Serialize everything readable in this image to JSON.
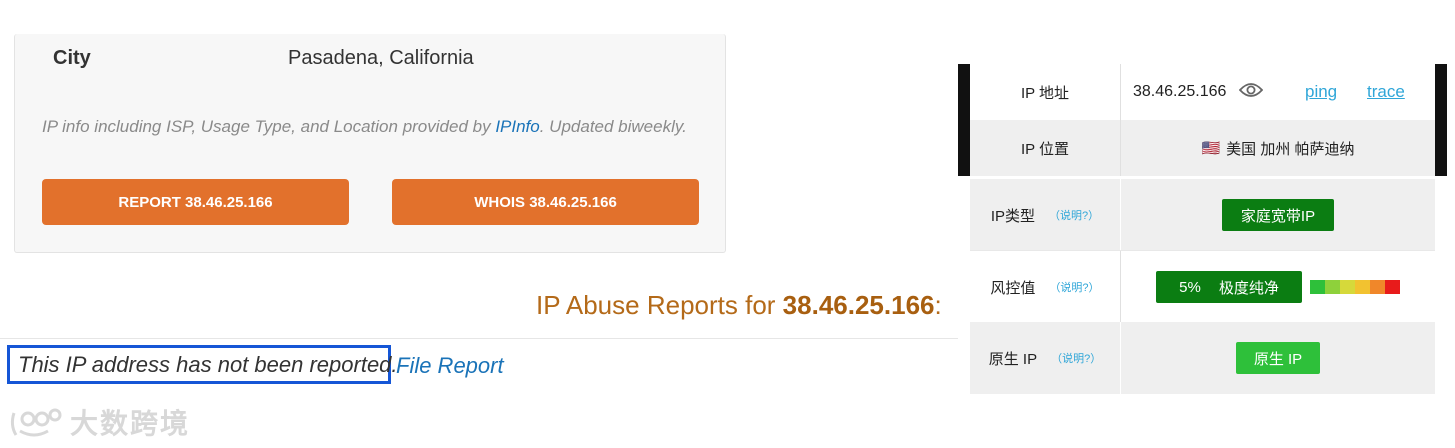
{
  "ip_info_card": {
    "city_label": "City",
    "city_value": "Pasadena, California",
    "note_prefix": "IP info including ISP, Usage Type, and Location provided by ",
    "note_link": "IPInfo",
    "note_suffix": ". Updated biweekly.",
    "report_button": "REPORT 38.46.25.166",
    "whois_button": "WHOIS 38.46.25.166"
  },
  "abuse": {
    "heading_prefix": "IP Abuse Reports for ",
    "heading_ip": "38.46.25.166",
    "heading_suffix": ":",
    "status_text": "This IP address has not been reported.",
    "file_report_link": "File Report"
  },
  "watermark": {
    "text": "大数跨境"
  },
  "ip_panel": {
    "address_label": "IP 地址",
    "address_value": "38.46.25.166",
    "ping_link": "ping",
    "trace_link": "trace",
    "location_label": "IP 位置",
    "location_flag": "🇺🇸",
    "location_value": "美国 加州 帕萨迪纳",
    "type_label": "IP类型",
    "type_explain": "（说明?）",
    "type_value": "家庭宽带IP",
    "risk_label": "风控值",
    "risk_explain": "（说明?）",
    "risk_percent": "5%",
    "risk_text": "极度纯净",
    "risk_scale_colors": [
      "#2ec03a",
      "#8ed13b",
      "#d6d93a",
      "#f2c230",
      "#f0872a",
      "#e81b1b"
    ],
    "native_label": "原生 IP",
    "native_explain": "（说明?）",
    "native_value": "原生 IP"
  },
  "colors": {
    "report_button_bg": "#e2712c",
    "link_blue": "#1a73b8",
    "heading_orange": "#b46a19",
    "highlight_box": "#1556d6",
    "badge_dark_green": "#0b7d12",
    "badge_light_green": "#2ec03a",
    "panel_link": "#2fa6d8"
  }
}
